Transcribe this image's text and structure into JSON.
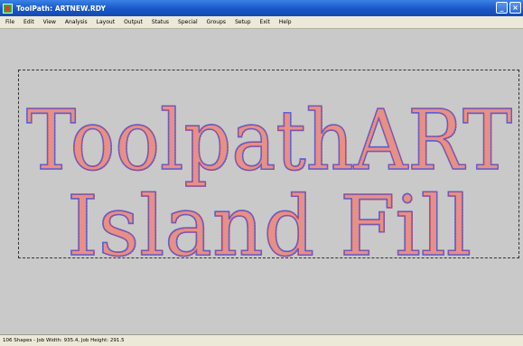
{
  "window": {
    "title": "ToolPath: ARTNEW.RDY",
    "minimize_glyph": "_",
    "close_glyph": "×"
  },
  "menu": {
    "items": [
      "File",
      "Edit",
      "View",
      "Analysis",
      "Layout",
      "Output",
      "Status",
      "Special",
      "Groups",
      "Setup",
      "Exit",
      "Help"
    ]
  },
  "artwork": {
    "line1": "ToolpathART",
    "line2": "Island Fill",
    "colors": {
      "fill": "#e88f86",
      "outline": "#5a63d8",
      "toolpath": "#d8322a",
      "bounds": "#333333",
      "canvas": "#c9c9c9"
    }
  },
  "status": {
    "text": "106 Shapes - Job Width: 935.4, Job Height: 291.5"
  }
}
